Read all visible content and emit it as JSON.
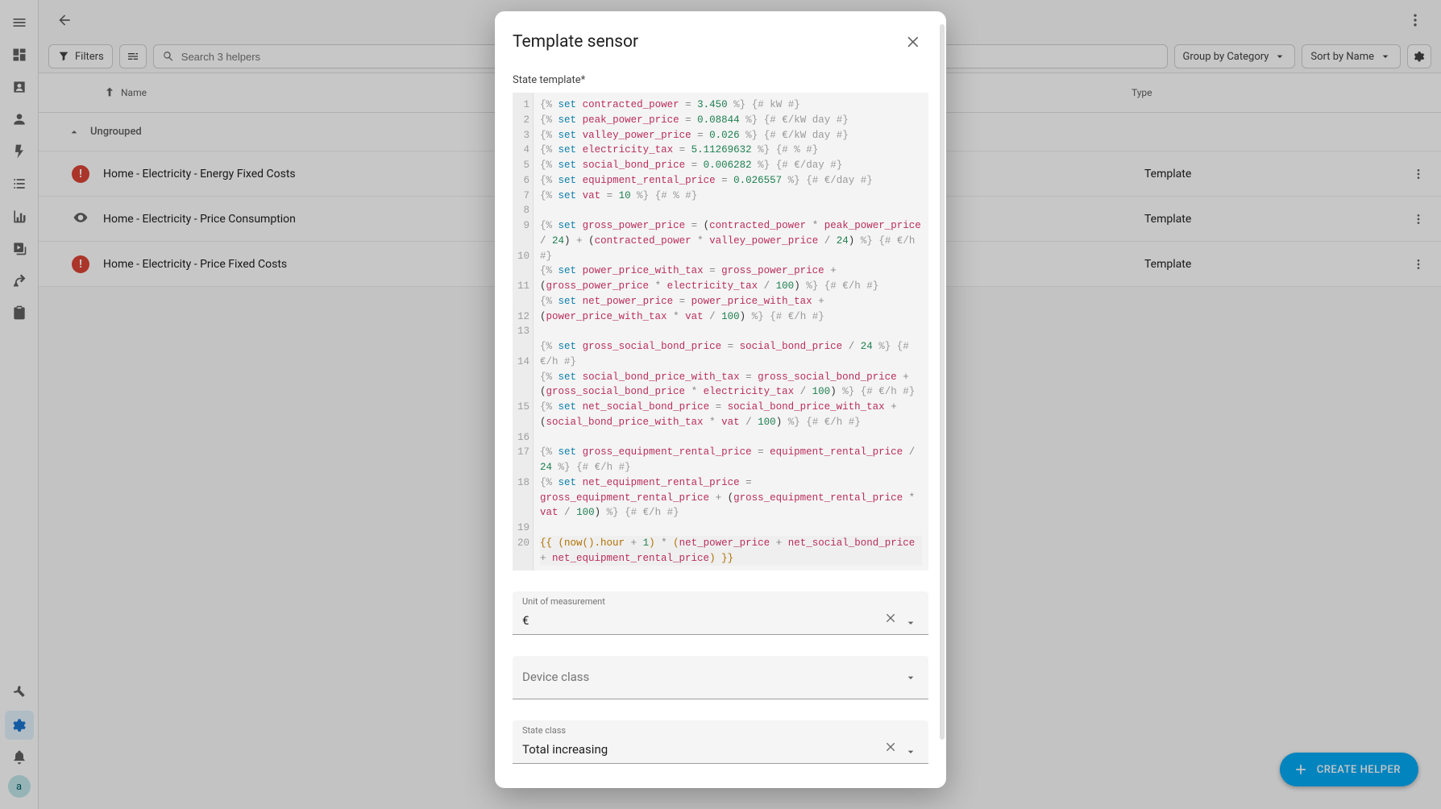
{
  "sidebar": {
    "avatar_initial": "a"
  },
  "topbar": {},
  "toolbar": {
    "filters_label": "Filters",
    "search_placeholder": "Search 3 helpers",
    "group_label": "Group by Category",
    "sort_label": "Sort by Name"
  },
  "table": {
    "col_name": "Name",
    "col_type": "Type",
    "group_label": "Ungrouped",
    "rows": [
      {
        "status": "alert",
        "name": "Home - Electricity - Energy Fixed Costs",
        "type": "Template"
      },
      {
        "status": "eye",
        "name": "Home - Electricity - Price Consumption",
        "type": "Template"
      },
      {
        "status": "alert",
        "name": "Home - Electricity - Price Fixed Costs",
        "type": "Template"
      }
    ]
  },
  "fab": {
    "label": "CREATE HELPER"
  },
  "dialog": {
    "title": "Template sensor",
    "state_template_label": "State template*",
    "unit_label": "Unit of measurement",
    "unit_value": "€",
    "device_class_label": "Device class",
    "device_class_value": "",
    "state_class_label": "State class",
    "state_class_value": "Total increasing",
    "code": {
      "line_numbers": [
        "1",
        "2",
        "3",
        "4",
        "5",
        "6",
        "7",
        "8",
        "9",
        "",
        "10",
        "",
        "11",
        "",
        "12",
        "13",
        "",
        "14",
        "",
        "",
        "15",
        "",
        "16",
        "17",
        "",
        "18",
        "",
        "",
        "19",
        "20",
        ""
      ],
      "vars_defined": {
        "contracted_power": 3.45,
        "peak_power_price": 0.08844,
        "valley_power_price": 0.026,
        "electricity_tax": 5.11269632,
        "social_bond_price": 0.006282,
        "equipment_rental_price": 0.026557,
        "vat": 10
      },
      "tokens": {
        "set": "set",
        "contracted_power": "contracted_power",
        "peak_power_price": "peak_power_price",
        "valley_power_price": "valley_power_price",
        "electricity_tax": "electricity_tax",
        "social_bond_price": "social_bond_price",
        "equipment_rental_price": "equipment_rental_price",
        "vat": "vat",
        "gross_power_price": "gross_power_price",
        "power_price_with_tax": "power_price_with_tax",
        "net_power_price": "net_power_price",
        "gross_social_bond_price": "gross_social_bond_price",
        "social_bond_price_with_tax": "social_bond_price_with_tax",
        "net_social_bond_price": "net_social_bond_price",
        "gross_equipment_rental_price": "gross_equipment_rental_price",
        "net_equipment_rental_price": "net_equipment_rental_price",
        "now_hour": "now().hour"
      },
      "numbers": {
        "n3_450": "3.450",
        "n0_08844": "0.08844",
        "n0_026": "0.026",
        "n5_11269632": "5.11269632",
        "n0_006282": "0.006282",
        "n0_026557": "0.026557",
        "n10": "10",
        "n24": "24",
        "n100": "100",
        "n1": "1"
      },
      "comments": {
        "kw": "{# kW #}",
        "e_kw_day": "{# €/kW day #}",
        "pct": "{# % #}",
        "e_day": "{# €/day #}",
        "e_h": "{# €/h #}"
      }
    }
  }
}
